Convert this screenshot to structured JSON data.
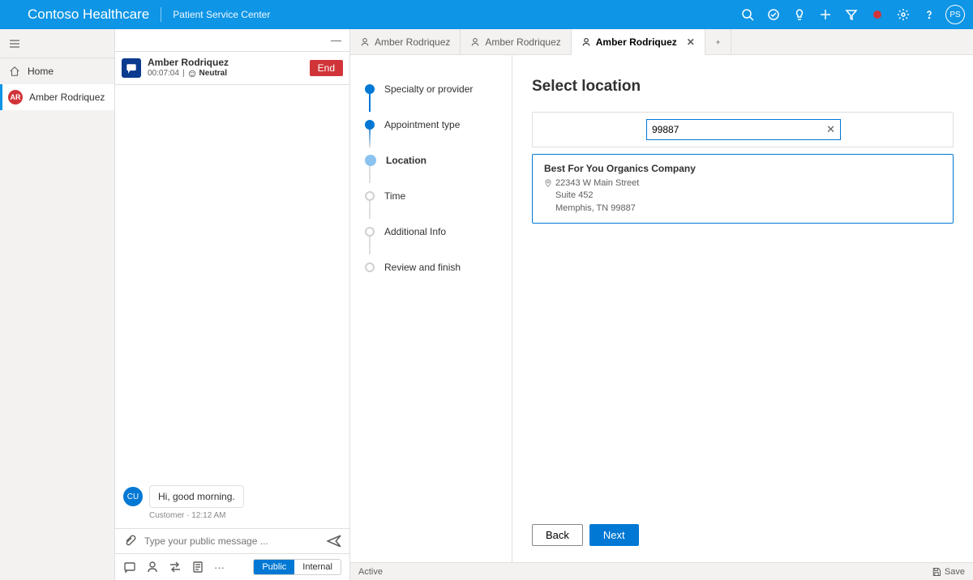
{
  "topbar": {
    "brand": "Contoso Healthcare",
    "subtitle": "Patient Service Center",
    "avatar_initials": "PS"
  },
  "nav": {
    "home_label": "Home",
    "session_label": "Amber Rodriquez",
    "session_initials": "AR"
  },
  "chat": {
    "name": "Amber Rodriquez",
    "timer": "00:07:04",
    "sentiment": "Neutral",
    "end_label": "End",
    "msg_avatar": "CU",
    "msg_text": "Hi, good morning.",
    "msg_meta": "Customer · 12:12 AM",
    "input_placeholder": "Type your public message ...",
    "pill_public": "Public",
    "pill_internal": "Internal"
  },
  "tabs": [
    {
      "label": "Amber Rodriquez",
      "active": false
    },
    {
      "label": "Amber Rodriquez",
      "active": false
    },
    {
      "label": "Amber Rodriquez",
      "active": true
    }
  ],
  "steps": [
    {
      "label": "Specialty or provider",
      "state": "done"
    },
    {
      "label": "Appointment type",
      "state": "done"
    },
    {
      "label": "Location",
      "state": "current"
    },
    {
      "label": "Time",
      "state": "future"
    },
    {
      "label": "Additional Info",
      "state": "future"
    },
    {
      "label": "Review and finish",
      "state": "future"
    }
  ],
  "location": {
    "heading": "Select location",
    "search_value": "99887",
    "result": {
      "name": "Best For You Organics Company",
      "addr1": "22343 W Main Street",
      "addr2": "Suite 452",
      "addr3": "Memphis, TN 99887"
    },
    "back_label": "Back",
    "next_label": "Next"
  },
  "status": {
    "state": "Active",
    "save": "Save"
  }
}
